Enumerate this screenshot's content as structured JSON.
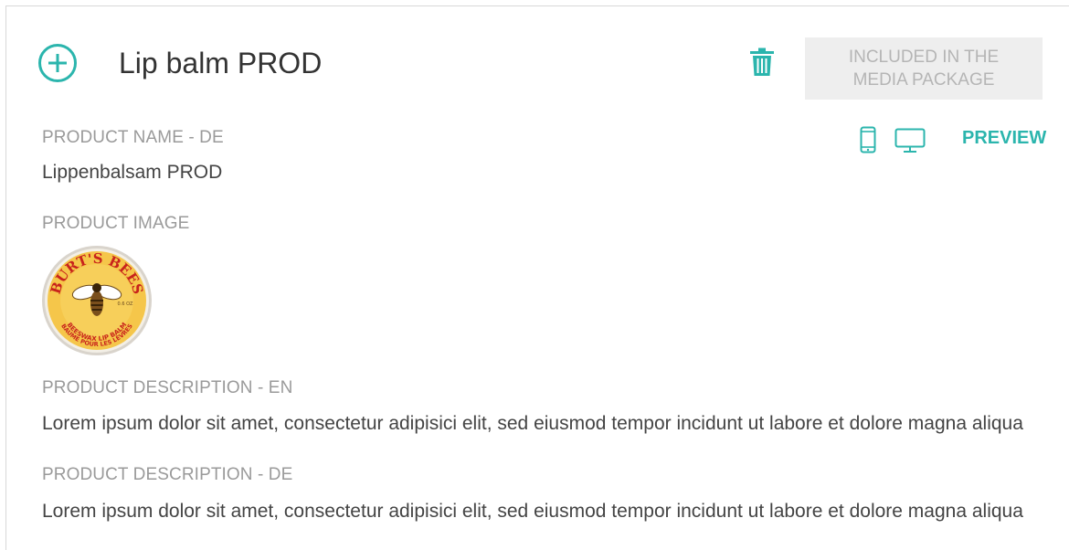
{
  "header": {
    "title": "Lip balm PROD",
    "badge_line1": "INCLUDED IN THE",
    "badge_line2": "MEDIA PACKAGE"
  },
  "preview": {
    "label": "PREVIEW"
  },
  "fields": {
    "name_de_label": "PRODUCT NAME - DE",
    "name_de_value": "Lippenbalsam PROD",
    "image_label": "PRODUCT IMAGE",
    "desc_en_label": "PRODUCT DESCRIPTION - EN",
    "desc_en_value": "Lorem ipsum dolor sit amet, consectetur adipisici elit, sed eiusmod tempor incidunt ut labore et dolore magna aliqua",
    "desc_de_label": "PRODUCT DESCRIPTION - DE",
    "desc_de_value": "Lorem ipsum dolor sit amet, consectetur adipisici elit, sed eiusmod tempor incidunt ut labore et dolore magna aliqua"
  },
  "product_image": {
    "brand_text": "BURT'S BEES",
    "bottom_text": "BEESWAX LIP BALM",
    "bottom_text_2": "BAUME POUR LES LÈVRES",
    "weight_text": "0.6 OZ"
  },
  "colors": {
    "accent": "#2bb5ad",
    "label": "#9a9a9a",
    "text": "#444444",
    "badge_bg": "#eeeeee",
    "badge_text": "#b5b5b5"
  },
  "icons": {
    "add": "plus-circle-icon",
    "delete": "trash-icon",
    "mobile": "mobile-icon",
    "desktop": "desktop-icon"
  }
}
